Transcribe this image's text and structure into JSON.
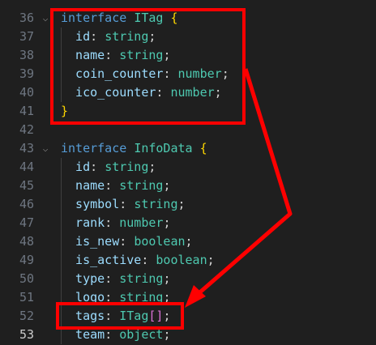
{
  "editor": {
    "lines": [
      {
        "num": "36",
        "fold": "⌵",
        "guide": false,
        "tokens": [
          {
            "t": "interface",
            "c": "kw"
          },
          {
            "t": " ",
            "c": "punct"
          },
          {
            "t": "ITag",
            "c": "type"
          },
          {
            "t": " ",
            "c": "punct"
          },
          {
            "t": "{",
            "c": "brace1"
          }
        ]
      },
      {
        "num": "37",
        "fold": "",
        "guide": true,
        "tokens": [
          {
            "t": "  id",
            "c": "prop"
          },
          {
            "t": ": ",
            "c": "punct"
          },
          {
            "t": "string",
            "c": "type"
          },
          {
            "t": ";",
            "c": "punct"
          }
        ]
      },
      {
        "num": "38",
        "fold": "",
        "guide": true,
        "tokens": [
          {
            "t": "  name",
            "c": "prop"
          },
          {
            "t": ": ",
            "c": "punct"
          },
          {
            "t": "string",
            "c": "type"
          },
          {
            "t": ";",
            "c": "punct"
          }
        ]
      },
      {
        "num": "39",
        "fold": "",
        "guide": true,
        "tokens": [
          {
            "t": "  coin_counter",
            "c": "prop"
          },
          {
            "t": ": ",
            "c": "punct"
          },
          {
            "t": "number",
            "c": "type"
          },
          {
            "t": ";",
            "c": "punct"
          }
        ]
      },
      {
        "num": "40",
        "fold": "",
        "guide": true,
        "tokens": [
          {
            "t": "  ico_counter",
            "c": "prop"
          },
          {
            "t": ": ",
            "c": "punct"
          },
          {
            "t": "number",
            "c": "type"
          },
          {
            "t": ";",
            "c": "punct"
          }
        ]
      },
      {
        "num": "41",
        "fold": "",
        "guide": false,
        "tokens": [
          {
            "t": "}",
            "c": "brace1"
          }
        ]
      },
      {
        "num": "42",
        "fold": "",
        "guide": false,
        "tokens": []
      },
      {
        "num": "43",
        "fold": "⌵",
        "guide": false,
        "tokens": [
          {
            "t": "interface",
            "c": "kw"
          },
          {
            "t": " ",
            "c": "punct"
          },
          {
            "t": "InfoData",
            "c": "type"
          },
          {
            "t": " ",
            "c": "punct"
          },
          {
            "t": "{",
            "c": "brace1"
          }
        ]
      },
      {
        "num": "44",
        "fold": "",
        "guide": true,
        "tokens": [
          {
            "t": "  id",
            "c": "prop"
          },
          {
            "t": ": ",
            "c": "punct"
          },
          {
            "t": "string",
            "c": "type"
          },
          {
            "t": ";",
            "c": "punct"
          }
        ]
      },
      {
        "num": "45",
        "fold": "",
        "guide": true,
        "tokens": [
          {
            "t": "  name",
            "c": "prop"
          },
          {
            "t": ": ",
            "c": "punct"
          },
          {
            "t": "string",
            "c": "type"
          },
          {
            "t": ";",
            "c": "punct"
          }
        ]
      },
      {
        "num": "46",
        "fold": "",
        "guide": true,
        "tokens": [
          {
            "t": "  symbol",
            "c": "prop"
          },
          {
            "t": ": ",
            "c": "punct"
          },
          {
            "t": "string",
            "c": "type"
          },
          {
            "t": ";",
            "c": "punct"
          }
        ]
      },
      {
        "num": "47",
        "fold": "",
        "guide": true,
        "tokens": [
          {
            "t": "  rank",
            "c": "prop"
          },
          {
            "t": ": ",
            "c": "punct"
          },
          {
            "t": "number",
            "c": "type"
          },
          {
            "t": ";",
            "c": "punct"
          }
        ]
      },
      {
        "num": "48",
        "fold": "",
        "guide": true,
        "tokens": [
          {
            "t": "  is_new",
            "c": "prop"
          },
          {
            "t": ": ",
            "c": "punct"
          },
          {
            "t": "boolean",
            "c": "type"
          },
          {
            "t": ";",
            "c": "punct"
          }
        ]
      },
      {
        "num": "49",
        "fold": "",
        "guide": true,
        "tokens": [
          {
            "t": "  is_active",
            "c": "prop"
          },
          {
            "t": ": ",
            "c": "punct"
          },
          {
            "t": "boolean",
            "c": "type"
          },
          {
            "t": ";",
            "c": "punct"
          }
        ]
      },
      {
        "num": "50",
        "fold": "",
        "guide": true,
        "tokens": [
          {
            "t": "  type",
            "c": "prop"
          },
          {
            "t": ": ",
            "c": "punct"
          },
          {
            "t": "string",
            "c": "type"
          },
          {
            "t": ";",
            "c": "punct"
          }
        ]
      },
      {
        "num": "51",
        "fold": "",
        "guide": true,
        "tokens": [
          {
            "t": "  logo",
            "c": "prop"
          },
          {
            "t": ": ",
            "c": "punct"
          },
          {
            "t": "string",
            "c": "type"
          },
          {
            "t": ";",
            "c": "punct"
          }
        ]
      },
      {
        "num": "52",
        "fold": "",
        "guide": true,
        "tokens": [
          {
            "t": "  tags",
            "c": "prop"
          },
          {
            "t": ": ",
            "c": "punct"
          },
          {
            "t": "ITag",
            "c": "type"
          },
          {
            "t": "[]",
            "c": "brace2"
          },
          {
            "t": ";",
            "c": "punct"
          }
        ]
      },
      {
        "num": "53",
        "fold": "",
        "guide": true,
        "current": true,
        "tokens": [
          {
            "t": "  team",
            "c": "prop"
          },
          {
            "t": ": ",
            "c": "punct"
          },
          {
            "t": "object",
            "c": "type"
          },
          {
            "t": ";",
            "c": "punct"
          }
        ]
      }
    ]
  },
  "annotations": {
    "color": "#ff0000",
    "highlights": [
      "itag-interface-block",
      "tags-field"
    ],
    "arrow": "itag-block-to-tags-field"
  }
}
